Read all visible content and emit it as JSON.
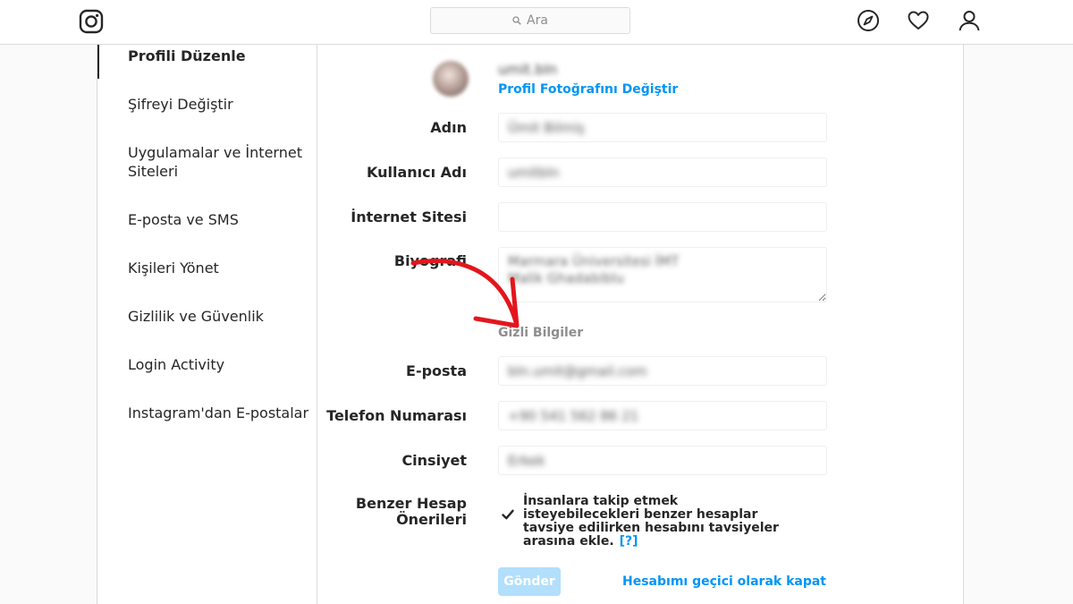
{
  "header": {
    "search_placeholder": "Ara",
    "icons": [
      "instagram-logo",
      "compass-icon",
      "heart-icon",
      "profile-icon"
    ]
  },
  "sidebar": {
    "items": [
      {
        "label": "Profili Düzenle",
        "active": true
      },
      {
        "label": "Şifreyi Değiştir"
      },
      {
        "label": "Uygulamalar ve İnternet Siteleri"
      },
      {
        "label": "E-posta ve SMS"
      },
      {
        "label": "Kişileri Yönet"
      },
      {
        "label": "Gizlilik ve Güvenlik"
      },
      {
        "label": "Login Activity"
      },
      {
        "label": "Instagram'dan E-postalar"
      }
    ]
  },
  "profile": {
    "username": "umit.bln",
    "change_photo_label": "Profil Fotoğrafını Değiştir"
  },
  "form": {
    "name_label": "Adın",
    "name_value": "Ümit Bilmiş",
    "username_label": "Kullanıcı Adı",
    "username_value": "umitbln",
    "website_label": "İnternet Sitesi",
    "website_value": "",
    "bio_label": "Biyografi",
    "bio_value": "Marmara Üniversitesi İMT\nMalik Ghadabiblu",
    "private_section_title": "Gizli Bilgiler",
    "email_label": "E-posta",
    "email_value": "bln.umit@gmail.com",
    "phone_label": "Telefon Numarası",
    "phone_value": "+90 541 562 86 21",
    "gender_label": "Cinsiyet",
    "gender_value": "Erkek",
    "similar_label_line1": "Benzer Hesap",
    "similar_label_line2": "Önerileri",
    "similar_checked": true,
    "similar_text": "İnsanlara takip etmek isteyebilecekleri benzer hesaplar tavsiye edilirken hesabını tavsiyeler arasına ekle.",
    "help_label": "[?]",
    "submit_label": "Gönder",
    "disable_label": "Hesabımı geçici olarak kapat"
  },
  "colors": {
    "accent": "#0095f6",
    "arrow": "#e3161d",
    "submit_disabled": "#b2dffc"
  }
}
